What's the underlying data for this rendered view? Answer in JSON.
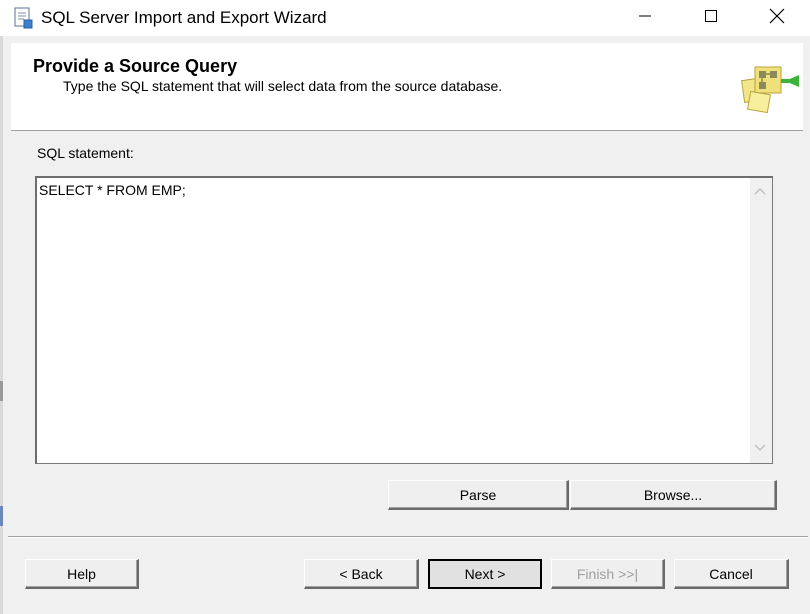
{
  "window": {
    "title": "SQL Server Import and Export Wizard",
    "icon": "wizard-app-icon"
  },
  "header": {
    "title": "Provide a Source Query",
    "subtitle": "Type the SQL statement that will select data from the source database.",
    "icon": "wizard-page-icon"
  },
  "form": {
    "sql_label": "SQL statement:",
    "sql_value": "SELECT * FROM EMP;"
  },
  "buttons": {
    "parse": "Parse",
    "browse": "Browse...",
    "help": "Help",
    "back": "< Back",
    "next": "Next >",
    "finish": "Finish >>|",
    "cancel": "Cancel"
  },
  "colors": {
    "disabled_text": "#a0a0a0",
    "header_background": "#ffffff",
    "dialog_background": "#f0f0f0"
  }
}
